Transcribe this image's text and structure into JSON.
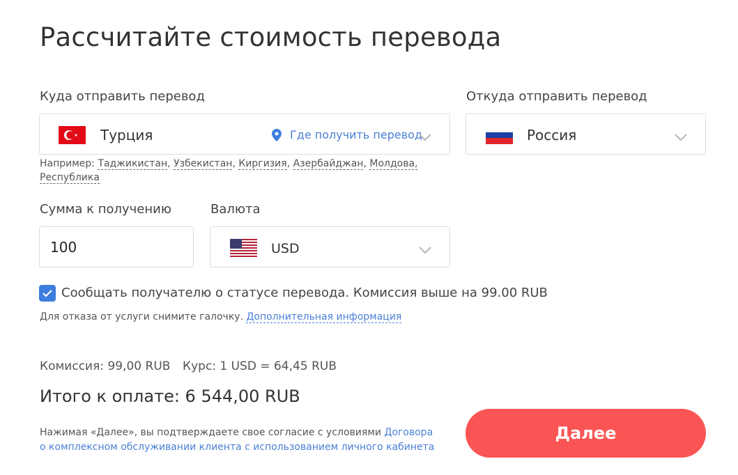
{
  "title": "Рассчитайте стоимость перевода",
  "destination": {
    "label": "Куда отправить перевод",
    "country": "Турция",
    "where_link": "Где получить перевод",
    "examples_prefix": "Например:",
    "examples": [
      "Таджикистан",
      "Узбекистан",
      "Киргизия",
      "Азербайджан",
      "Молдова, Республика"
    ]
  },
  "origin": {
    "label": "Откуда отправить перевод",
    "country": "Россия"
  },
  "amount": {
    "label": "Сумма к получению",
    "value": "100"
  },
  "currency": {
    "label": "Валюта",
    "value": "USD"
  },
  "notify": {
    "checked": true,
    "text": "Сообщать получателю о статусе перевода. Комиссия выше на 99.00 RUB",
    "hint": "Для отказа от услуги снимите галочку.",
    "more_link": "Дополнительная информация"
  },
  "summary": {
    "commission": "Комиссия: 99,00 RUB",
    "rate": "Курс: 1 USD = 64,45 RUB",
    "total": "Итого к оплате: 6 544,00 RUB"
  },
  "agreement": {
    "text": "Нажимая «Далее», вы подтверждаете свое согласие с условиями",
    "link_line1": "Договора",
    "link_line2": "о комплексном обслуживании клиента с использованием личного кабинета"
  },
  "next_button": "Далее",
  "colors": {
    "accent_blue": "#3d7ede",
    "button_red": "#fb5454",
    "link_blue": "#4a7fd4"
  }
}
